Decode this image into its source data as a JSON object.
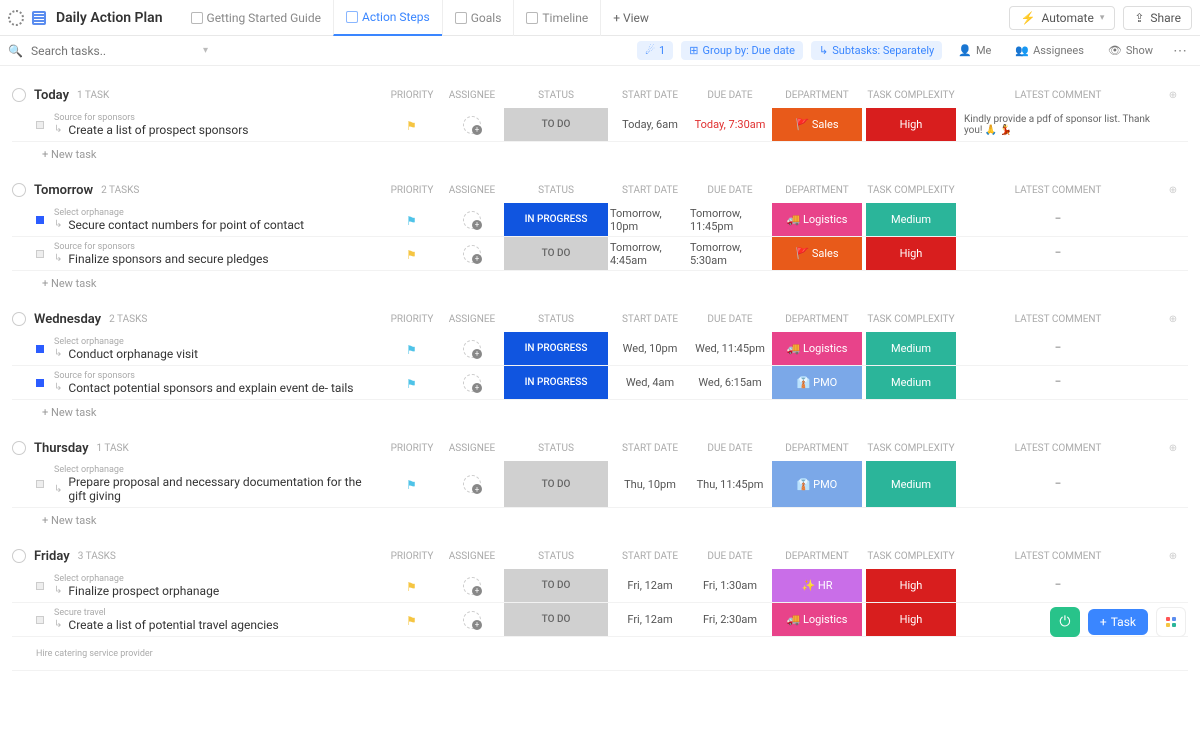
{
  "title": "Daily Action Plan",
  "tabs": [
    {
      "label": "Getting Started Guide"
    },
    {
      "label": "Action Steps",
      "active": true
    },
    {
      "label": "Goals"
    },
    {
      "label": "Timeline"
    }
  ],
  "viewBtn": "+ View",
  "automate": "Automate",
  "share": "Share",
  "search": {
    "placeholder": "Search tasks.."
  },
  "filters": {
    "funnel": "1",
    "group": "Group by: Due date",
    "subtasks": "Subtasks: Separately",
    "me": "Me",
    "assignees": "Assignees",
    "show": "Show"
  },
  "columns": {
    "priority": "PRIORITY",
    "assignee": "ASSIGNEE",
    "status": "STATUS",
    "start": "START DATE",
    "due": "DUE DATE",
    "dept": "DEPARTMENT",
    "complex": "TASK COMPLEXITY",
    "comment": "LATEST COMMENT"
  },
  "newtask": "+ New task",
  "groups": [
    {
      "name": "Today",
      "count": "1 TASK",
      "rows": [
        {
          "parent": "Source for sponsors",
          "name": "Create a list of prospect sponsors",
          "flag": "yellow",
          "status": "TO DO",
          "stClass": "st-todo",
          "start": "Today, 6am",
          "due": "Today, 7:30am",
          "dueRed": true,
          "dept": "🚩 Sales",
          "deptClass": "dp-sales",
          "complex": "High",
          "cxClass": "cx-high",
          "comment": "Kindly provide a pdf of sponsor list. Thank you! 🙏 💃",
          "sq": ""
        }
      ]
    },
    {
      "name": "Tomorrow",
      "count": "2 TASKS",
      "rows": [
        {
          "parent": "Select orphanage",
          "name": "Secure contact numbers for point of contact",
          "flag": "cyan",
          "status": "IN PROGRESS",
          "stClass": "st-prog",
          "start": "Tomorrow, 10pm",
          "due": "Tomorrow, 11:45pm",
          "dept": "🚚 Logistics",
          "deptClass": "dp-log",
          "complex": "Medium",
          "cxClass": "cx-med",
          "comment": "–",
          "sq": "blue"
        },
        {
          "parent": "Source for sponsors",
          "name": "Finalize sponsors and secure pledges",
          "flag": "yellow",
          "status": "TO DO",
          "stClass": "st-todo",
          "start": "Tomorrow, 4:45am",
          "due": "Tomorrow, 5:30am",
          "dept": "🚩 Sales",
          "deptClass": "dp-sales",
          "complex": "High",
          "cxClass": "cx-high",
          "comment": "–",
          "sq": ""
        }
      ]
    },
    {
      "name": "Wednesday",
      "count": "2 TASKS",
      "rows": [
        {
          "parent": "Select orphanage",
          "name": "Conduct orphanage visit",
          "flag": "cyan",
          "status": "IN PROGRESS",
          "stClass": "st-prog",
          "start": "Wed, 10pm",
          "due": "Wed, 11:45pm",
          "dept": "🚚 Logistics",
          "deptClass": "dp-log",
          "complex": "Medium",
          "cxClass": "cx-med",
          "comment": "–",
          "sq": "blue"
        },
        {
          "parent": "Source for sponsors",
          "name": "Contact potential sponsors and explain event de-\ntails",
          "flag": "cyan",
          "status": "IN PROGRESS",
          "stClass": "st-prog",
          "start": "Wed, 4am",
          "due": "Wed, 6:15am",
          "dept": "👔 PMO",
          "deptClass": "dp-pmo",
          "complex": "Medium",
          "cxClass": "cx-med",
          "comment": "–",
          "sq": "blue"
        }
      ]
    },
    {
      "name": "Thursday",
      "count": "1 TASK",
      "rows": [
        {
          "parent": "Select orphanage",
          "name": "Prepare proposal and necessary documentation for the gift giving",
          "flag": "cyan",
          "status": "TO DO",
          "stClass": "st-todo",
          "start": "Thu, 10pm",
          "due": "Thu, 11:45pm",
          "dept": "👔 PMO",
          "deptClass": "dp-pmo",
          "complex": "Medium",
          "cxClass": "cx-med",
          "comment": "–",
          "sq": ""
        }
      ]
    },
    {
      "name": "Friday",
      "count": "3 TASKS",
      "rows": [
        {
          "parent": "Select orphanage",
          "name": "Finalize prospect orphanage",
          "flag": "yellow",
          "status": "TO DO",
          "stClass": "st-todo",
          "start": "Fri, 12am",
          "due": "Fri, 1:30am",
          "dept": "✨ HR",
          "deptClass": "dp-hr",
          "complex": "High",
          "cxClass": "cx-high",
          "comment": "–",
          "sq": ""
        },
        {
          "parent": "Secure travel",
          "name": "Create a list of potential travel agencies",
          "flag": "yellow",
          "status": "TO DO",
          "stClass": "st-todo",
          "start": "Fri, 12am",
          "due": "Fri, 2:30am",
          "dept": "🚚 Logistics",
          "deptClass": "dp-log",
          "complex": "High",
          "cxClass": "cx-high",
          "comment": "–",
          "sq": ""
        },
        {
          "parent": "Hire catering service provider",
          "name": "",
          "flag": "",
          "status": "",
          "stClass": "",
          "start": "",
          "due": "",
          "dept": "",
          "deptClass": "",
          "complex": "",
          "cxClass": "",
          "comment": "",
          "sq": "",
          "stub": true
        }
      ]
    }
  ],
  "fab": {
    "task": "Task"
  }
}
